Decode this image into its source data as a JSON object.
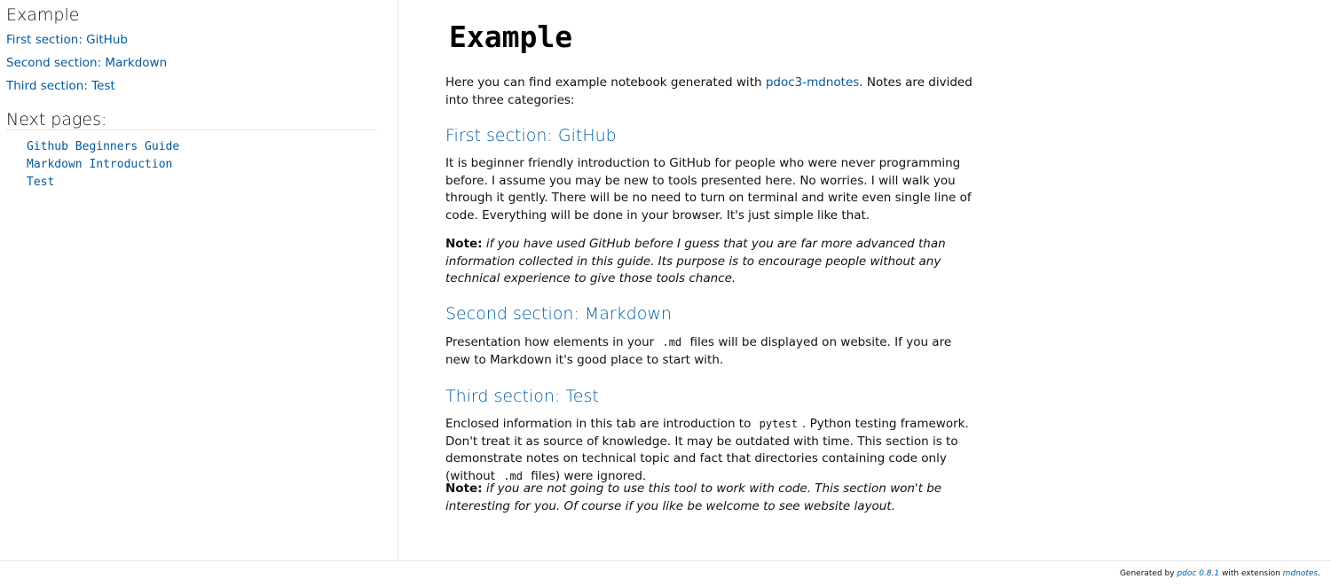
{
  "sidebar": {
    "title": "Example",
    "links": [
      "First section: GitHub",
      "Second section: Markdown",
      "Third section: Test"
    ],
    "next_title": "Next pages:",
    "next_links": [
      "Github Beginners Guide",
      "Markdown Introduction",
      "Test"
    ]
  },
  "main": {
    "title": "Example",
    "intro": {
      "before": "Here you can find example notebook generated with ",
      "link": "pdoc3-mdnotes",
      "after": ". Notes are divided into three categories:"
    },
    "sections": [
      {
        "heading": "First section: GitHub",
        "body": "It is beginner friendly introduction to GitHub for people who were never programming before. I assume you may be new to tools presented here. No worries. I will walk you through it gently. There will be no need to turn on terminal and write even single line of code. Everything will be done in your browser. It's just simple like that.",
        "note_label": "Note:",
        "note": "if you have used GitHub before I guess that you are far more advanced than information collected in this guide. Its purpose is to encourage people without any technical experience to give those tools chance."
      },
      {
        "heading": "Second section: Markdown",
        "body_before": "Presentation how elements in your ",
        "code": ".md",
        "body_after": " files will be displayed on website. If you are new to Markdown it's good place to start with."
      },
      {
        "heading": "Third section: Test",
        "body_part1": "Enclosed information in this tab are introduction to ",
        "code1": "pytest",
        "body_part2": ". Python testing framework. Don't treat it as source of knowledge. It may be outdated with time. This section is to demonstrate notes on technical topic and fact that directories containing code only (without ",
        "code2": ".md",
        "body_part3": " files) were ignored.",
        "note_label": "Note:",
        "note": "if you are not going to use this tool to work with code. This section won't be interesting for you. Of course if you like be welcome to see website layout."
      }
    ]
  },
  "footer": {
    "generated_by": "Generated by ",
    "pdoc_link": "pdoc 0.8.1",
    "with_extension": " with extension ",
    "ext_link": "mdnotes",
    "end": "."
  }
}
